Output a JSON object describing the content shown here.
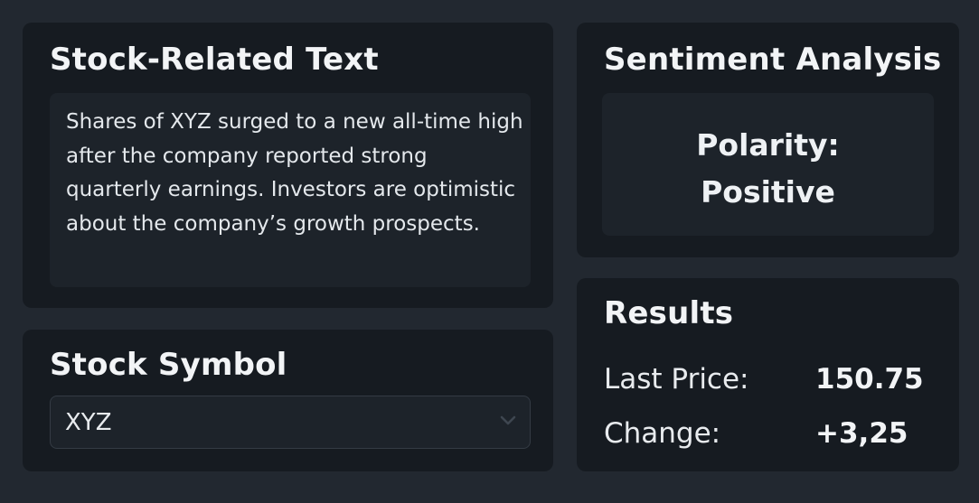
{
  "stock_text": {
    "title": "Stock-Related Text",
    "body": "Shares of XYZ surged to a new all-time high after the company reported strong quarterly earnings. Investors are optimistic about the company’s growth prospects."
  },
  "stock_symbol": {
    "title": "Stock Symbol",
    "selected": "XYZ",
    "icon": "chevron-down-icon"
  },
  "sentiment": {
    "title": "Sentiment Analysis",
    "polarity_label": "Polarity:",
    "polarity_value": "Positive"
  },
  "results": {
    "title": "Results",
    "last_price_label": "Last Price:",
    "last_price_value": "150.75",
    "change_label": "Change:",
    "change_value": "+3,25"
  },
  "colors": {
    "background": "#222830",
    "card": "#161b21",
    "inner": "#1d232a",
    "text": "#eef1f4"
  }
}
